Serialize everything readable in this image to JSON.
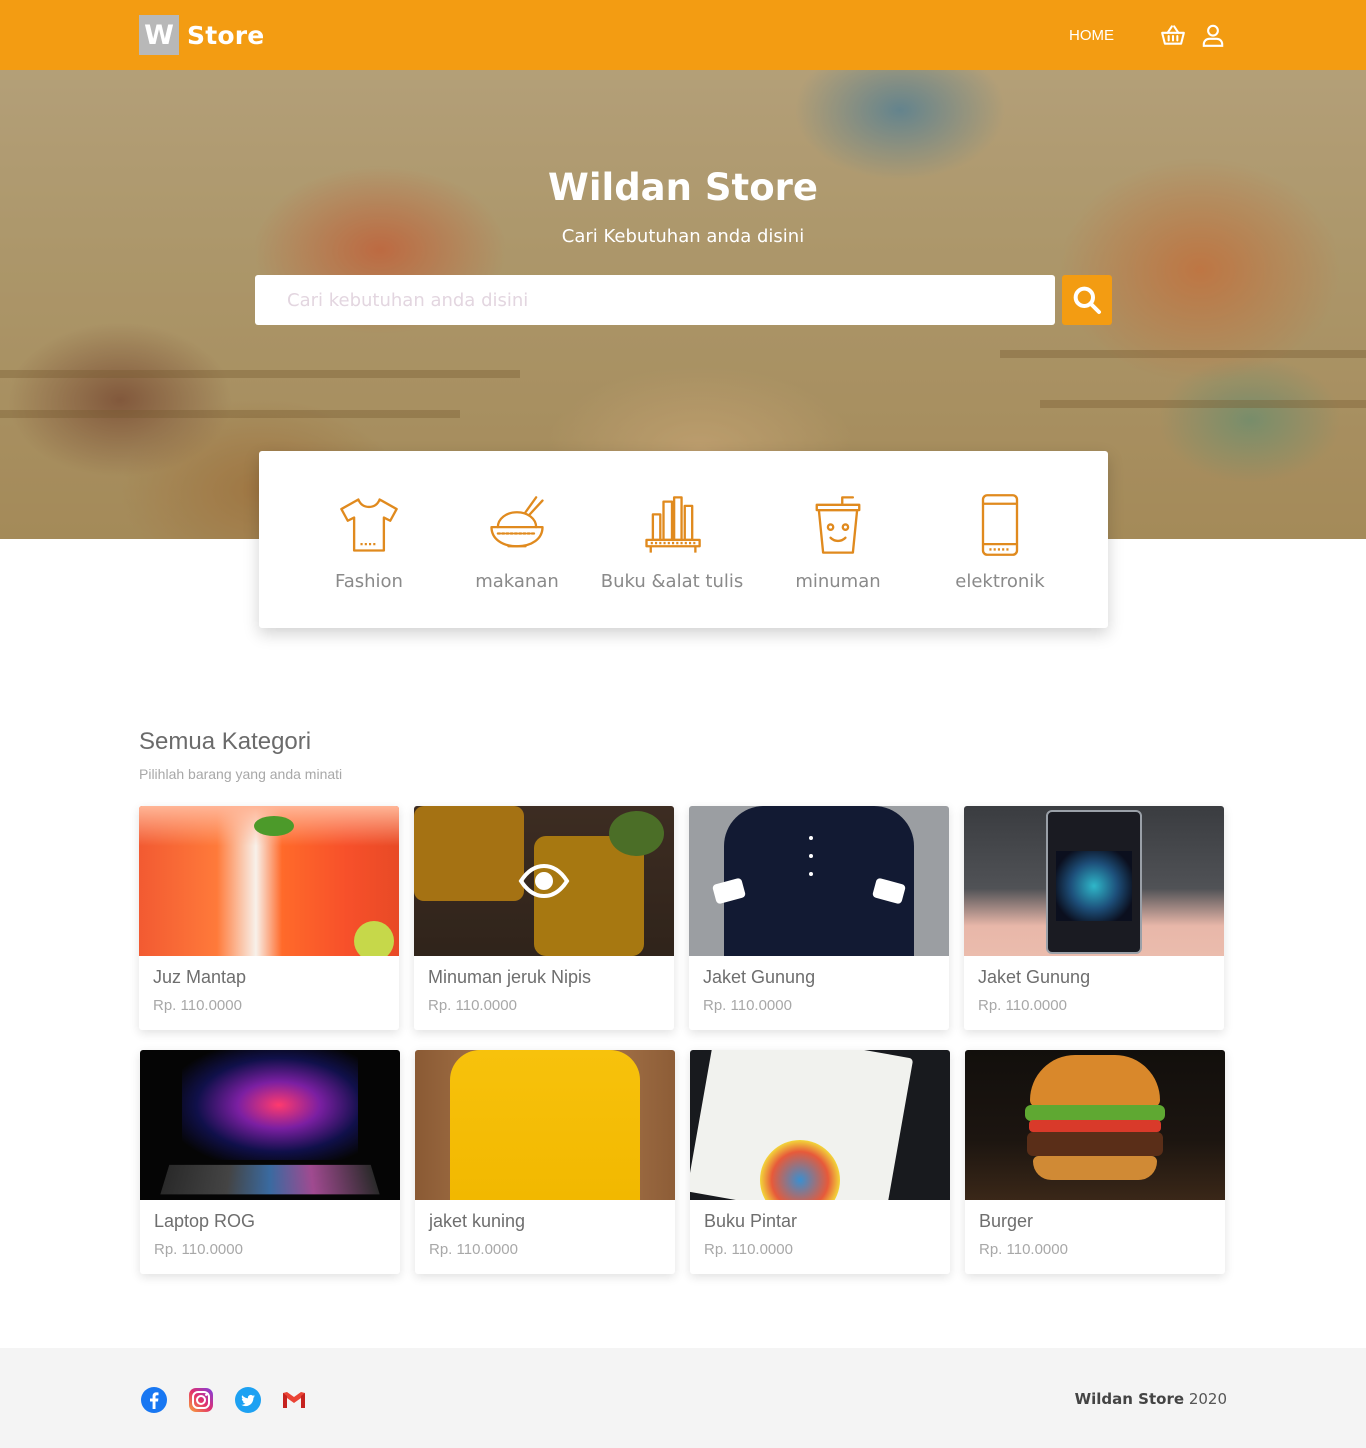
{
  "brand": {
    "logo_letter": "W",
    "name": "Store"
  },
  "nav": {
    "home": "HOME"
  },
  "hero": {
    "title": "Wildan Store",
    "subtitle": "Cari Kebutuhan anda disini",
    "search_placeholder": "Cari kebutuhan anda disini"
  },
  "categories": [
    {
      "label": "Fashion",
      "icon": "tshirt-icon"
    },
    {
      "label": "makanan",
      "icon": "rice-bowl-icon"
    },
    {
      "label": "Buku &alat tulis",
      "icon": "books-icon"
    },
    {
      "label": "minuman",
      "icon": "drink-cup-icon"
    },
    {
      "label": "elektronik",
      "icon": "smartphone-icon"
    }
  ],
  "section": {
    "title": "Semua Kategori",
    "subtitle": "Pilihlah barang yang anda minati"
  },
  "products": [
    {
      "name": "Juz Mantap",
      "price": "Rp. 110.0000"
    },
    {
      "name": "Minuman jeruk Nipis",
      "price": "Rp. 110.0000"
    },
    {
      "name": "Jaket Gunung",
      "price": "Rp. 110.0000"
    },
    {
      "name": "Jaket Gunung",
      "price": "Rp. 110.0000"
    },
    {
      "name": "Laptop ROG",
      "price": "Rp. 110.0000"
    },
    {
      "name": "jaket kuning",
      "price": "Rp. 110.0000"
    },
    {
      "name": "Buku Pintar",
      "price": "Rp. 110.0000"
    },
    {
      "name": "Burger",
      "price": "Rp. 110.0000"
    }
  ],
  "footer": {
    "socials": [
      "facebook-icon",
      "instagram-icon",
      "twitter-icon",
      "gmail-icon"
    ],
    "brand": "Wildan Store",
    "year": "2020"
  },
  "colors": {
    "accent": "#f39c12",
    "icon_orange": "#e08a1e"
  }
}
